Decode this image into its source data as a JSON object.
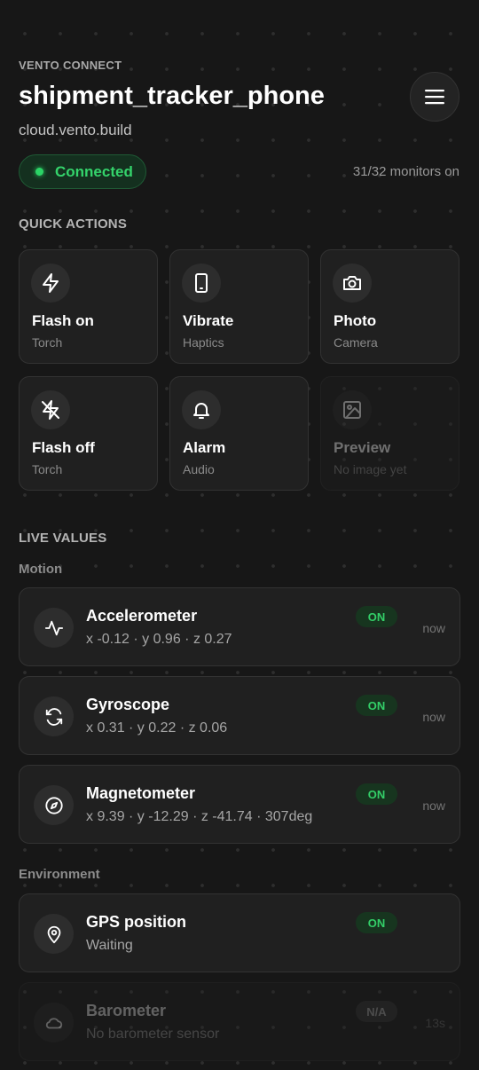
{
  "header": {
    "brand": "VENTO CONNECT",
    "device_name": "shipment_tracker_phone",
    "host": "cloud.vento.build",
    "status": "Connected",
    "monitors": "31/32 monitors on"
  },
  "quick_actions": {
    "title": "QUICK ACTIONS",
    "items": [
      {
        "label": "Flash on",
        "sub": "Torch",
        "icon": "flash-icon"
      },
      {
        "label": "Vibrate",
        "sub": "Haptics",
        "icon": "phone-icon"
      },
      {
        "label": "Photo",
        "sub": "Camera",
        "icon": "camera-icon"
      },
      {
        "label": "Flash off",
        "sub": "Torch",
        "icon": "flash-off-icon"
      },
      {
        "label": "Alarm",
        "sub": "Audio",
        "icon": "bell-icon"
      },
      {
        "label": "Preview",
        "sub": "No image yet",
        "icon": "image-icon"
      }
    ]
  },
  "live_values": {
    "title": "LIVE VALUES",
    "groups": [
      {
        "title": "Motion",
        "sensors": [
          {
            "name": "Accelerometer",
            "value": "x -0.12 · y 0.96 · z 0.27",
            "badge": "ON",
            "time": "now",
            "icon": "activity-icon"
          },
          {
            "name": "Gyroscope",
            "value": "x 0.31 · y 0.22 · z 0.06",
            "badge": "ON",
            "time": "now",
            "icon": "refresh-icon"
          },
          {
            "name": "Magnetometer",
            "value": "x 9.39 · y -12.29 · z -41.74 · 307deg",
            "badge": "ON",
            "time": "now",
            "icon": "compass-icon"
          }
        ]
      },
      {
        "title": "Environment",
        "sensors": [
          {
            "name": "GPS position",
            "value": "Waiting",
            "badge": "ON",
            "time": "",
            "icon": "map-pin-icon"
          },
          {
            "name": "Barometer",
            "value": "No barometer sensor",
            "badge": "N/A",
            "time": "13s",
            "icon": "cloud-icon"
          }
        ]
      }
    ]
  },
  "colors": {
    "background": "#171717",
    "card": "#202020",
    "accent_green": "#34d36b",
    "badge_bg": "#17351f"
  }
}
